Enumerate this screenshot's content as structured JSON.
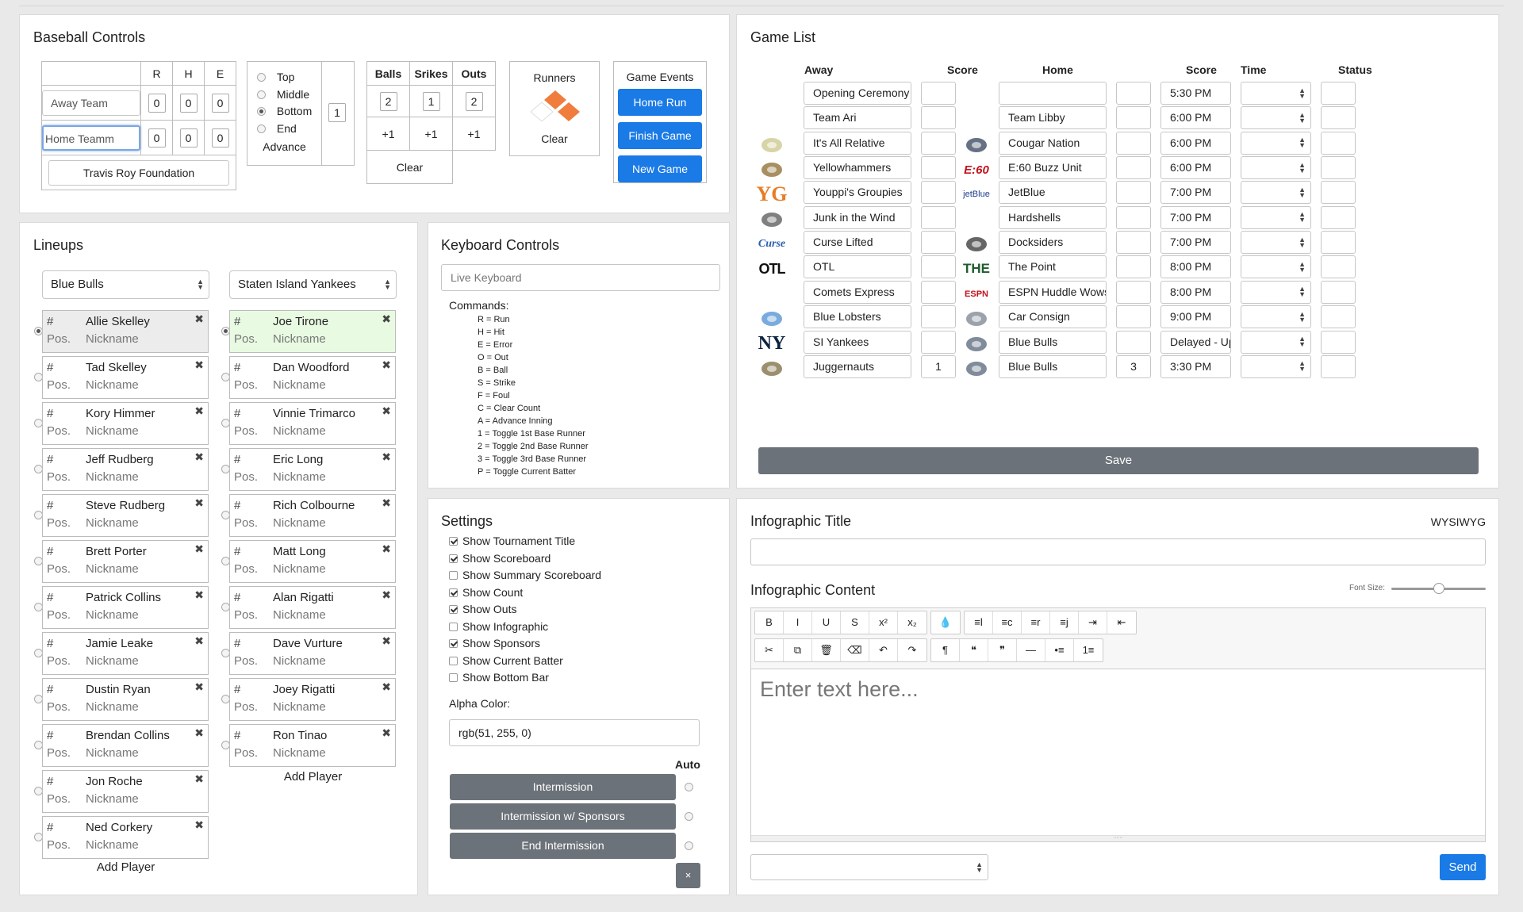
{
  "baseball_controls": {
    "title": "Baseball Controls",
    "rhe_headers": [
      "R",
      "H",
      "E"
    ],
    "away_team": "Away Team",
    "home_team": "Home Teamm",
    "away_scores": [
      "0",
      "0",
      "0"
    ],
    "home_scores": [
      "0",
      "0",
      "0"
    ],
    "sponsor": "Travis Roy Foundation",
    "inning_options": [
      "Top",
      "Middle",
      "Bottom",
      "End"
    ],
    "inning_selected": 2,
    "inning_number": "1",
    "advance": "Advance",
    "count_headers": [
      "Balls",
      "Srikes",
      "Outs"
    ],
    "count_values": [
      "2",
      "1",
      "2"
    ],
    "plus": "+1",
    "clear": "Clear",
    "runners_title": "Runners",
    "runners_clear": "Clear",
    "events_title": "Game Events",
    "events": [
      "Home Run",
      "Finish Game",
      "New Game"
    ]
  },
  "lineups": {
    "title": "Lineups",
    "away_team": "Blue Bulls",
    "home_team": "Staten Island Yankees",
    "hash": "#",
    "pos": "Pos.",
    "nick": "Nickname",
    "remove": "✖",
    "away_players": [
      "Allie Skelley",
      "Tad Skelley",
      "Kory Himmer",
      "Jeff Rudberg",
      "Steve Rudberg",
      "Brett Porter",
      "Patrick Collins",
      "Jamie Leake",
      "Dustin Ryan",
      "Brendan Collins",
      "Jon Roche",
      "Ned Corkery"
    ],
    "home_players": [
      "Joe Tirone",
      "Dan Woodford",
      "Vinnie Trimarco",
      "Eric Long",
      "Rich Colbourne",
      "Matt Long",
      "Alan Rigatti",
      "Dave Vurture",
      "Joey Rigatti",
      "Ron Tinao"
    ],
    "add_player": "Add Player"
  },
  "keyboard": {
    "title": "Keyboard Controls",
    "placeholder": "Live Keyboard",
    "commands_title": "Commands:",
    "commands": [
      "R = Run",
      "H = Hit",
      "E = Error",
      "O = Out",
      "B = Ball",
      "S = Strike",
      "F = Foul",
      "C = Clear Count",
      "A = Advance Inning",
      "1 = Toggle 1st Base Runner",
      "2 = Toggle 2nd Base Runner",
      "3 = Toggle 3rd Base Runner",
      "P = Toggle Current Batter"
    ]
  },
  "settings": {
    "title": "Settings",
    "options": [
      {
        "label": "Show Tournament Title",
        "checked": true
      },
      {
        "label": "Show Scoreboard",
        "checked": true
      },
      {
        "label": "Show Summary Scoreboard",
        "checked": false
      },
      {
        "label": "Show Count",
        "checked": true
      },
      {
        "label": "Show Outs",
        "checked": true
      },
      {
        "label": "Show Infographic",
        "checked": false
      },
      {
        "label": "Show Sponsors",
        "checked": true
      },
      {
        "label": "Show Current Batter",
        "checked": false
      },
      {
        "label": "Show Bottom Bar",
        "checked": false
      }
    ],
    "alpha_label": "Alpha Color:",
    "alpha_value": "rgb(51, 255, 0)",
    "auto_label": "Auto",
    "intermissions": [
      "Intermission",
      "Intermission w/ Sponsors",
      "End Intermission"
    ],
    "close": "×"
  },
  "game_list": {
    "title": "Game List",
    "headers": {
      "away": "Away",
      "score": "Score",
      "home": "Home",
      "time": "Time",
      "status": "Status"
    },
    "games": [
      {
        "away": "Opening Ceremony",
        "away_score": "",
        "home": "",
        "home_score": "",
        "time": "5:30 PM",
        "status": "",
        "away_logo": "",
        "home_logo": ""
      },
      {
        "away": "Team Ari",
        "away_score": "",
        "home": "Team Libby",
        "home_score": "",
        "time": "6:00 PM",
        "status": "",
        "away_logo": "",
        "home_logo": ""
      },
      {
        "away": "It's All Relative",
        "away_score": "",
        "home": "Cougar Nation",
        "home_score": "",
        "time": "6:00 PM",
        "status": "",
        "away_logo": "relative-logo",
        "home_logo": "cougar-logo"
      },
      {
        "away": "Yellowhammers",
        "away_score": "",
        "home": "E:60 Buzz Unit",
        "home_score": "",
        "time": "6:00 PM",
        "status": "",
        "away_logo": "bird-logo",
        "home_logo": "E:60"
      },
      {
        "away": "Youppi's Groupies",
        "away_score": "",
        "home": "JetBlue",
        "home_score": "",
        "time": "7:00 PM",
        "status": "",
        "away_logo": "YG",
        "home_logo": "jetBlue"
      },
      {
        "away": "Junk in the Wind",
        "away_score": "",
        "home": "Hardshells",
        "home_score": "",
        "time": "7:00 PM",
        "status": "",
        "away_logo": "junk-logo",
        "home_logo": ""
      },
      {
        "away": "Curse Lifted",
        "away_score": "",
        "home": "Docksiders",
        "home_score": "",
        "time": "7:00 PM",
        "status": "",
        "away_logo": "Curse",
        "home_logo": "skull-logo"
      },
      {
        "away": "OTL",
        "away_score": "",
        "home": "The Point",
        "home_score": "",
        "time": "8:00 PM",
        "status": "",
        "away_logo": "OTL",
        "home_logo": "THE"
      },
      {
        "away": "Comets Express",
        "away_score": "",
        "home": "ESPN Huddle Wows",
        "home_score": "",
        "time": "8:00 PM",
        "status": "",
        "away_logo": "",
        "home_logo": "ESPN"
      },
      {
        "away": "Blue Lobsters",
        "away_score": "",
        "home": "Car Consign",
        "home_score": "",
        "time": "9:00 PM",
        "status": "",
        "away_logo": "lobster-logo",
        "home_logo": "car-logo"
      },
      {
        "away": "SI Yankees",
        "away_score": "",
        "home": "Blue Bulls",
        "home_score": "",
        "time": "Delayed - Up",
        "status": "",
        "away_logo": "NY",
        "home_logo": "bull-logo"
      },
      {
        "away": "Juggernauts",
        "away_score": "1",
        "home": "Blue Bulls",
        "home_score": "3",
        "time": "3:30 PM",
        "status": "",
        "away_logo": "jugg-logo",
        "home_logo": "bull-logo"
      }
    ],
    "save": "Save"
  },
  "infographic": {
    "title_label": "Infographic Title",
    "wysiwyg": "WYSIWYG",
    "content_label": "Infographic Content",
    "font_size_label": "Font Size:",
    "font_size_level": 0.5,
    "placeholder": "Enter text here...",
    "send": "Send",
    "toolbar_row1": [
      [
        "B",
        "I",
        "U",
        "S",
        "x²",
        "x₂"
      ],
      [
        "💧"
      ],
      [
        "≡l",
        "≡c",
        "≡r",
        "≡j",
        "⇥",
        "⇤"
      ]
    ],
    "toolbar_row2": [
      [
        "✂",
        "⧉",
        "🗑",
        "⌫",
        "↶",
        "↷"
      ],
      [
        "¶",
        "❝",
        "❞",
        "—",
        "•≡",
        "1≡"
      ]
    ]
  }
}
